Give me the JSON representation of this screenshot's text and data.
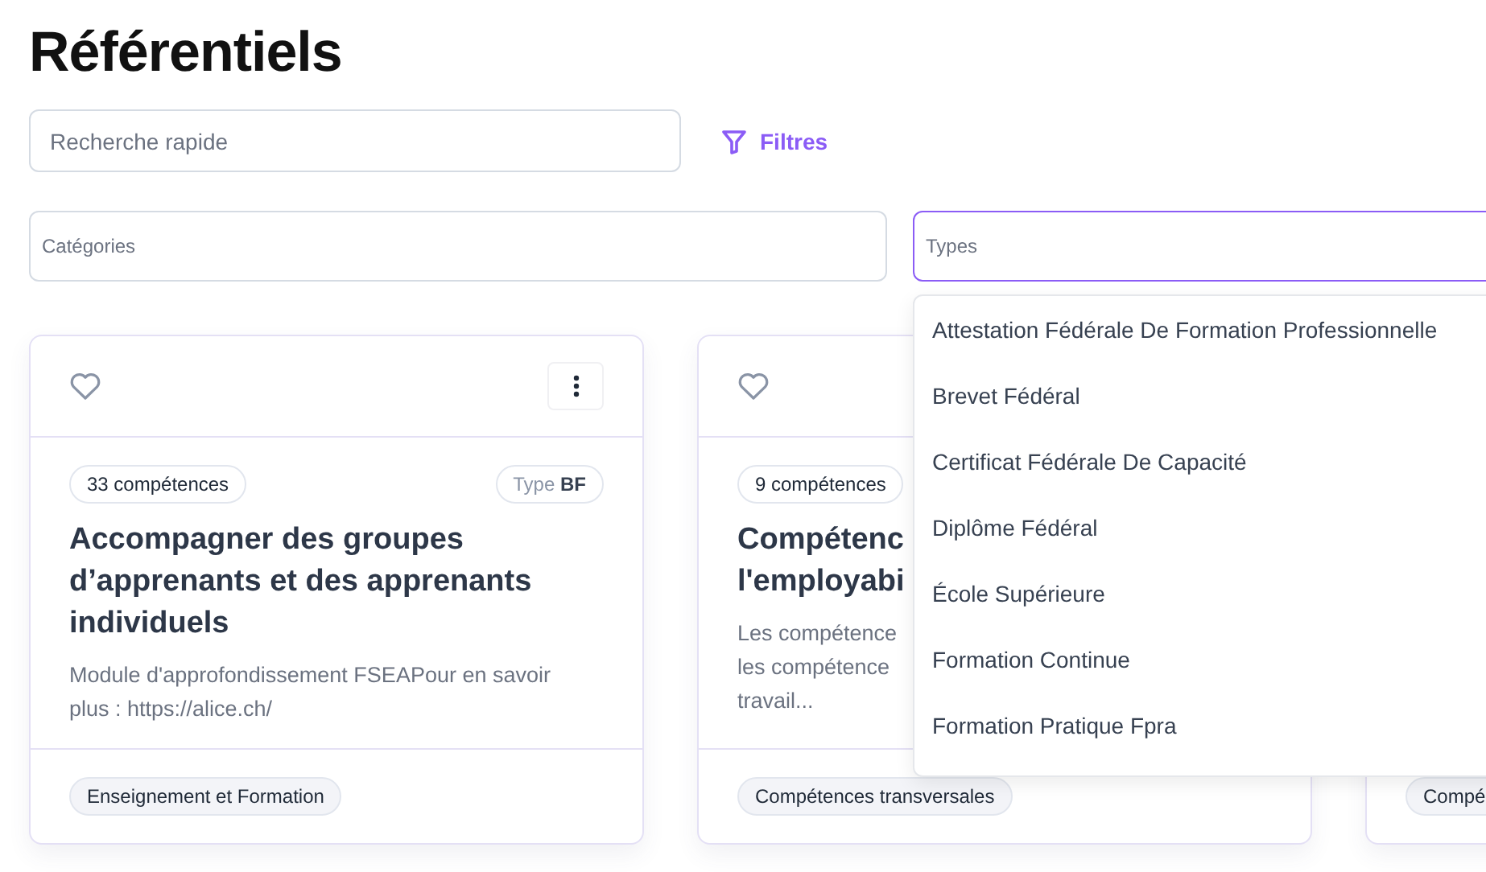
{
  "title": "Référentiels",
  "search": {
    "placeholder": "Recherche rapide",
    "focused": false
  },
  "filters_button": {
    "label": "Filtres"
  },
  "category_field": {
    "placeholder": "Catégories",
    "focused": false
  },
  "types_field": {
    "placeholder": "Types",
    "focused": true
  },
  "types_dropdown": {
    "options": [
      {
        "label": "Attestation Fédérale De Formation Professionnelle"
      },
      {
        "label": "Brevet Fédéral"
      },
      {
        "label": "Certificat Fédérale De Capacité"
      },
      {
        "label": "Diplôme Fédéral"
      },
      {
        "label": "École Supérieure"
      },
      {
        "label": "Formation Continue"
      },
      {
        "label": "Formation Pratique Fpra"
      }
    ]
  },
  "cards": [
    {
      "favorite": false,
      "menu_button": true,
      "count": "33 compétences",
      "type_label": "Type",
      "type_value": "BF",
      "title": [
        "Accompagner des groupes",
        "d’apprenants et des apprenants",
        "individuels"
      ],
      "description": [
        "Module d'approfondissement FSEAPour en savoir",
        "plus : https://alice.ch/"
      ],
      "tag": "Enseignement et Formation"
    },
    {
      "favorite": false,
      "count": "9 compétences",
      "title": [
        "Compétenc",
        "l'employabi"
      ],
      "description": [
        "Les compétence",
        "les compétence",
        "travail..."
      ],
      "tag": "Compétences transversales"
    },
    {
      "tag": "Compé"
    }
  ]
}
